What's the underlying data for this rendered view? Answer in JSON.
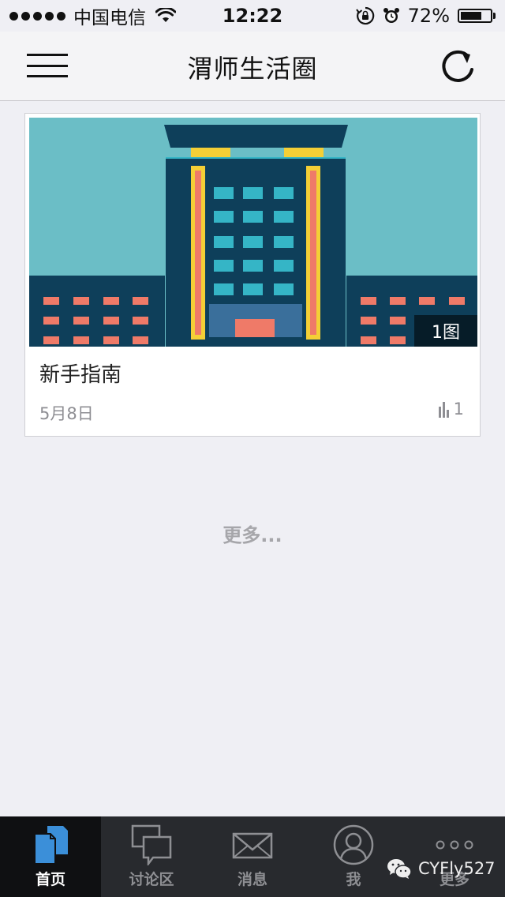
{
  "status_bar": {
    "carrier": "中国电信",
    "time": "12:22",
    "battery_percent_label": "72%",
    "battery_level": 0.72
  },
  "nav": {
    "title": "渭师生活圈"
  },
  "card": {
    "photo_count": "1图",
    "title": "新手指南",
    "date": "5月8日",
    "views": "1"
  },
  "more_link": "更多...",
  "tabs": [
    {
      "label": "首页",
      "icon": "document-icon",
      "active": true
    },
    {
      "label": "讨论区",
      "icon": "chat-bubbles-icon",
      "active": false
    },
    {
      "label": "消息",
      "icon": "envelope-icon",
      "active": false
    },
    {
      "label": "我",
      "icon": "user-icon",
      "active": false
    },
    {
      "label": "更多",
      "icon": "more-dots-icon",
      "active": false
    }
  ],
  "watermark": {
    "text": "CYFly527"
  },
  "colors": {
    "tab_bar": "#282a2e",
    "tab_active": "#0f1012",
    "accent_blue": "#3b8fd9",
    "sky": "#6bbec6",
    "building_dark": "#0e3f5a",
    "window_cyan": "#35b5c6",
    "window_red": "#ef7a68",
    "pillar_yellow": "#f4cf36"
  }
}
